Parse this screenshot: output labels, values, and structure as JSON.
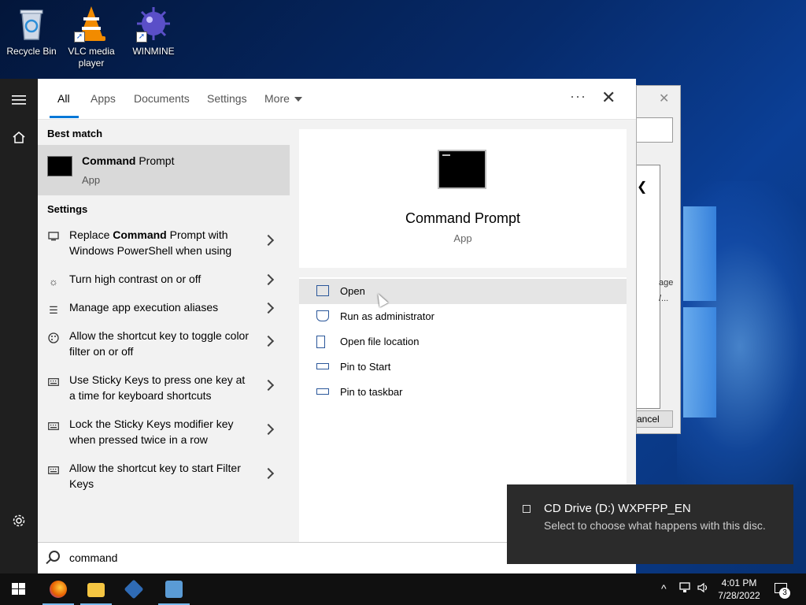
{
  "desktop": {
    "icons": [
      {
        "label": "Recycle Bin",
        "icon": "recycle-bin-icon"
      },
      {
        "label": "VLC media player",
        "icon": "vlc-icon"
      },
      {
        "label": "WINMINE",
        "icon": "minesweeper-icon"
      }
    ]
  },
  "behind_window": {
    "close": "✕",
    "text_line1": "age",
    "text_line2": "/...",
    "button": "ancel"
  },
  "start_strip": {
    "menu_icon": "hamburger-icon",
    "home_icon": "home-icon",
    "settings_icon": "gear-icon"
  },
  "tabs": {
    "all": "All",
    "apps": "Apps",
    "documents": "Documents",
    "settings": "Settings",
    "more": "More",
    "dots": "···",
    "close": "✕"
  },
  "results": {
    "best_match_heading": "Best match",
    "best_match": {
      "title_bold": "Command",
      "title_rest": " Prompt",
      "subtitle": "App"
    },
    "settings_heading": "Settings",
    "settings_items": [
      {
        "pre": "Replace ",
        "bold": "Command",
        "post": " Prompt with Windows PowerShell when using",
        "icon": "monitor-icon"
      },
      {
        "pre": "Turn high contrast on or off",
        "bold": "",
        "post": "",
        "icon": "brightness-icon"
      },
      {
        "pre": "Manage app execution aliases",
        "bold": "",
        "post": "",
        "icon": "list-icon"
      },
      {
        "pre": "Allow the shortcut key to toggle color filter on or off",
        "bold": "",
        "post": "",
        "icon": "palette-icon"
      },
      {
        "pre": "Use Sticky Keys to press one key at a time for keyboard shortcuts",
        "bold": "",
        "post": "",
        "icon": "keyboard-icon"
      },
      {
        "pre": "Lock the Sticky Keys modifier key when pressed twice in a row",
        "bold": "",
        "post": "",
        "icon": "keyboard-icon"
      },
      {
        "pre": "Allow the shortcut key to start Filter Keys",
        "bold": "",
        "post": "",
        "icon": "keyboard-icon"
      }
    ]
  },
  "preview": {
    "title": "Command Prompt",
    "subtitle": "App",
    "actions": [
      {
        "label": "Open",
        "icon": "open-icon"
      },
      {
        "label": "Run as administrator",
        "icon": "shield-icon"
      },
      {
        "label": "Open file location",
        "icon": "file-location-icon"
      },
      {
        "label": "Pin to Start",
        "icon": "pin-icon"
      },
      {
        "label": "Pin to taskbar",
        "icon": "pin-icon"
      }
    ]
  },
  "search": {
    "query": "command"
  },
  "toast": {
    "title": "CD Drive (D:) WXPFPP_EN",
    "body": "Select to choose what happens with this disc."
  },
  "taskbar": {
    "apps": [
      {
        "name": "firefox",
        "color": "#e66000"
      },
      {
        "name": "file-explorer",
        "color": "#f4c542"
      },
      {
        "name": "virtualbox",
        "color": "#2f6bb5"
      },
      {
        "name": "control-panel",
        "color": "#5a9bd5"
      }
    ],
    "time": "4:01 PM",
    "date": "7/28/2022",
    "notification_count": "3",
    "tray_chevron": "^",
    "accent": "#76b9ed"
  }
}
